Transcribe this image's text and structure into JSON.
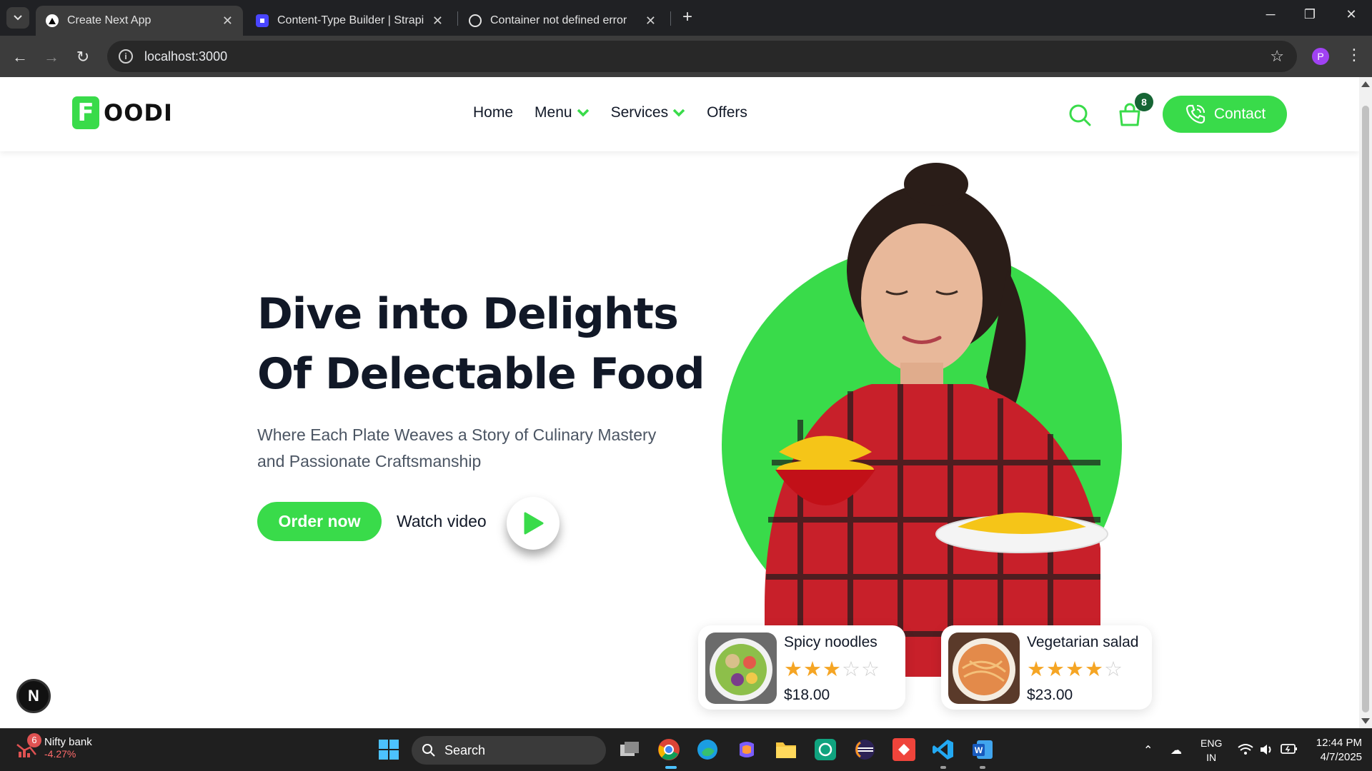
{
  "browser": {
    "tabs": [
      {
        "title": "Create Next App",
        "active": true
      },
      {
        "title": "Content-Type Builder | Strapi",
        "active": false
      },
      {
        "title": "Container not defined error",
        "active": false
      }
    ],
    "url": "localhost:3000",
    "profile_initial": "P"
  },
  "site": {
    "logo_letter": "F",
    "logo_rest": "OODI",
    "nav": [
      "Home",
      "Menu",
      "Services",
      "Offers"
    ],
    "cart_count": "8",
    "contact_label": "Contact",
    "accent": "#39db4a",
    "hero": {
      "title_line1": "Dive into Delights",
      "title_line2": "Of Delectable Food",
      "subtitle_line1": "Where Each Plate Weaves a Story of Culinary Mastery",
      "subtitle_line2": "and Passionate Craftsmanship",
      "order_label": "Order now",
      "watch_label": "Watch video"
    },
    "cards": [
      {
        "name": "Spicy noodles",
        "rating": 3,
        "max": 5,
        "price": "$18.00"
      },
      {
        "name": "Vegetarian salad",
        "rating": 4,
        "max": 5,
        "price": "$23.00"
      }
    ],
    "next_badge": "N"
  },
  "taskbar": {
    "widget_title": "Nifty bank",
    "widget_value": "-4.27%",
    "widget_badge": "6",
    "search_label": "Search",
    "lang_line1": "ENG",
    "lang_line2": "IN",
    "time": "12:44 PM",
    "date": "4/7/2025"
  }
}
